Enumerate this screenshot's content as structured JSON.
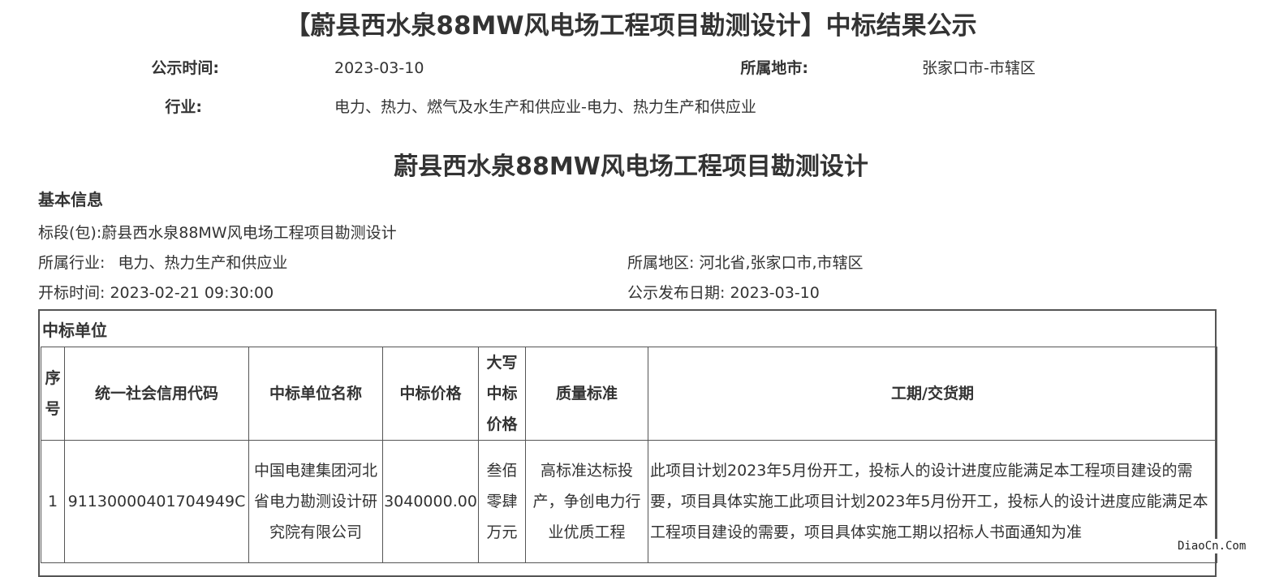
{
  "title": "【蔚县西水泉88MW风电场工程项目勘测设计】中标结果公示",
  "meta": {
    "announce_time_label": "公示时间:",
    "announce_time_value": "2023-03-10",
    "city_label": "所属地市:",
    "city_value": "张家口市-市辖区",
    "industry_label": "行业:",
    "industry_value": "电力、热力、燃气及水生产和供应业-电力、热力生产和供应业"
  },
  "project_title": "蔚县西水泉88MW风电场工程项目勘测设计",
  "basic_info": {
    "heading": "基本信息",
    "lot": "标段(包):蔚县西水泉88MW风电场工程项目勘测设计",
    "industry_label": "所属行业:",
    "industry_value": "电力、热力生产和供应业",
    "region": "所属地区: 河北省,张家口市,市辖区",
    "open_time": "开标时间: 2023-02-21 09:30:00",
    "publish_date": "公示发布日期: 2023-03-10"
  },
  "winner": {
    "heading": "中标单位",
    "columns": [
      "序号",
      "统一社会信用代码",
      "中标单位名称",
      "中标价格",
      "大写中标价格",
      "质量标准",
      "工期/交货期"
    ],
    "rows": [
      {
        "index": "1",
        "credit_code": "91130000401704949C",
        "name": "中国电建集团河北省电力勘测设计研究院有限公司",
        "price": "3040000.00",
        "price_uppercase": "叁佰零肆万元",
        "quality": "高标准达标投产，争创电力行业优质工程",
        "schedule": "此项目计划2023年5月份开工，投标人的设计进度应能满足本工程项目建设的需要，项目具体实施工此项目计划2023年5月份开工，投标人的设计进度应能满足本工程项目建设的需要，项目具体实施工期以招标人书面通知为准"
      }
    ]
  },
  "watermark": "DiaoCn.Com"
}
